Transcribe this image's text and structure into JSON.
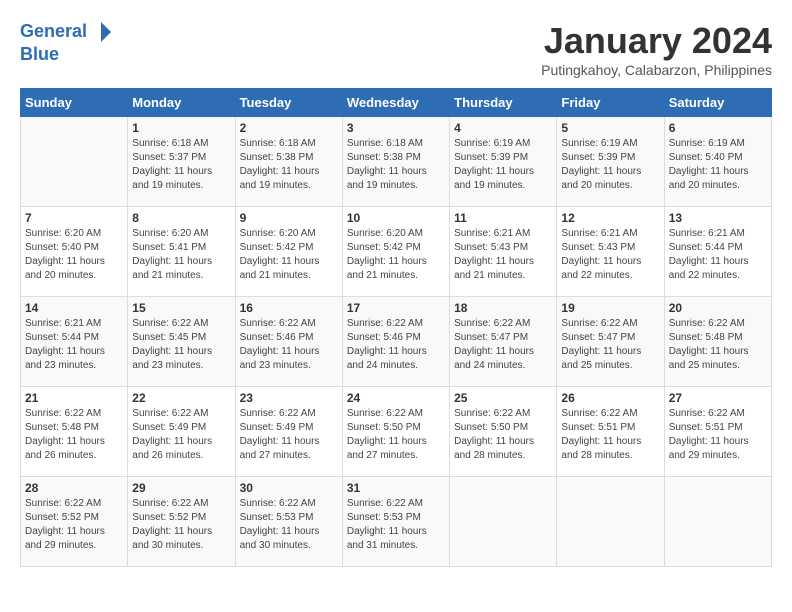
{
  "header": {
    "logo_line1": "General",
    "logo_line2": "Blue",
    "month": "January 2024",
    "location": "Putingkahoy, Calabarzon, Philippines"
  },
  "days_of_week": [
    "Sunday",
    "Monday",
    "Tuesday",
    "Wednesday",
    "Thursday",
    "Friday",
    "Saturday"
  ],
  "weeks": [
    [
      {
        "num": "",
        "info": ""
      },
      {
        "num": "1",
        "info": "Sunrise: 6:18 AM\nSunset: 5:37 PM\nDaylight: 11 hours\nand 19 minutes."
      },
      {
        "num": "2",
        "info": "Sunrise: 6:18 AM\nSunset: 5:38 PM\nDaylight: 11 hours\nand 19 minutes."
      },
      {
        "num": "3",
        "info": "Sunrise: 6:18 AM\nSunset: 5:38 PM\nDaylight: 11 hours\nand 19 minutes."
      },
      {
        "num": "4",
        "info": "Sunrise: 6:19 AM\nSunset: 5:39 PM\nDaylight: 11 hours\nand 19 minutes."
      },
      {
        "num": "5",
        "info": "Sunrise: 6:19 AM\nSunset: 5:39 PM\nDaylight: 11 hours\nand 20 minutes."
      },
      {
        "num": "6",
        "info": "Sunrise: 6:19 AM\nSunset: 5:40 PM\nDaylight: 11 hours\nand 20 minutes."
      }
    ],
    [
      {
        "num": "7",
        "info": "Sunrise: 6:20 AM\nSunset: 5:40 PM\nDaylight: 11 hours\nand 20 minutes."
      },
      {
        "num": "8",
        "info": "Sunrise: 6:20 AM\nSunset: 5:41 PM\nDaylight: 11 hours\nand 21 minutes."
      },
      {
        "num": "9",
        "info": "Sunrise: 6:20 AM\nSunset: 5:42 PM\nDaylight: 11 hours\nand 21 minutes."
      },
      {
        "num": "10",
        "info": "Sunrise: 6:20 AM\nSunset: 5:42 PM\nDaylight: 11 hours\nand 21 minutes."
      },
      {
        "num": "11",
        "info": "Sunrise: 6:21 AM\nSunset: 5:43 PM\nDaylight: 11 hours\nand 21 minutes."
      },
      {
        "num": "12",
        "info": "Sunrise: 6:21 AM\nSunset: 5:43 PM\nDaylight: 11 hours\nand 22 minutes."
      },
      {
        "num": "13",
        "info": "Sunrise: 6:21 AM\nSunset: 5:44 PM\nDaylight: 11 hours\nand 22 minutes."
      }
    ],
    [
      {
        "num": "14",
        "info": "Sunrise: 6:21 AM\nSunset: 5:44 PM\nDaylight: 11 hours\nand 23 minutes."
      },
      {
        "num": "15",
        "info": "Sunrise: 6:22 AM\nSunset: 5:45 PM\nDaylight: 11 hours\nand 23 minutes."
      },
      {
        "num": "16",
        "info": "Sunrise: 6:22 AM\nSunset: 5:46 PM\nDaylight: 11 hours\nand 23 minutes."
      },
      {
        "num": "17",
        "info": "Sunrise: 6:22 AM\nSunset: 5:46 PM\nDaylight: 11 hours\nand 24 minutes."
      },
      {
        "num": "18",
        "info": "Sunrise: 6:22 AM\nSunset: 5:47 PM\nDaylight: 11 hours\nand 24 minutes."
      },
      {
        "num": "19",
        "info": "Sunrise: 6:22 AM\nSunset: 5:47 PM\nDaylight: 11 hours\nand 25 minutes."
      },
      {
        "num": "20",
        "info": "Sunrise: 6:22 AM\nSunset: 5:48 PM\nDaylight: 11 hours\nand 25 minutes."
      }
    ],
    [
      {
        "num": "21",
        "info": "Sunrise: 6:22 AM\nSunset: 5:48 PM\nDaylight: 11 hours\nand 26 minutes."
      },
      {
        "num": "22",
        "info": "Sunrise: 6:22 AM\nSunset: 5:49 PM\nDaylight: 11 hours\nand 26 minutes."
      },
      {
        "num": "23",
        "info": "Sunrise: 6:22 AM\nSunset: 5:49 PM\nDaylight: 11 hours\nand 27 minutes."
      },
      {
        "num": "24",
        "info": "Sunrise: 6:22 AM\nSunset: 5:50 PM\nDaylight: 11 hours\nand 27 minutes."
      },
      {
        "num": "25",
        "info": "Sunrise: 6:22 AM\nSunset: 5:50 PM\nDaylight: 11 hours\nand 28 minutes."
      },
      {
        "num": "26",
        "info": "Sunrise: 6:22 AM\nSunset: 5:51 PM\nDaylight: 11 hours\nand 28 minutes."
      },
      {
        "num": "27",
        "info": "Sunrise: 6:22 AM\nSunset: 5:51 PM\nDaylight: 11 hours\nand 29 minutes."
      }
    ],
    [
      {
        "num": "28",
        "info": "Sunrise: 6:22 AM\nSunset: 5:52 PM\nDaylight: 11 hours\nand 29 minutes."
      },
      {
        "num": "29",
        "info": "Sunrise: 6:22 AM\nSunset: 5:52 PM\nDaylight: 11 hours\nand 30 minutes."
      },
      {
        "num": "30",
        "info": "Sunrise: 6:22 AM\nSunset: 5:53 PM\nDaylight: 11 hours\nand 30 minutes."
      },
      {
        "num": "31",
        "info": "Sunrise: 6:22 AM\nSunset: 5:53 PM\nDaylight: 11 hours\nand 31 minutes."
      },
      {
        "num": "",
        "info": ""
      },
      {
        "num": "",
        "info": ""
      },
      {
        "num": "",
        "info": ""
      }
    ]
  ]
}
